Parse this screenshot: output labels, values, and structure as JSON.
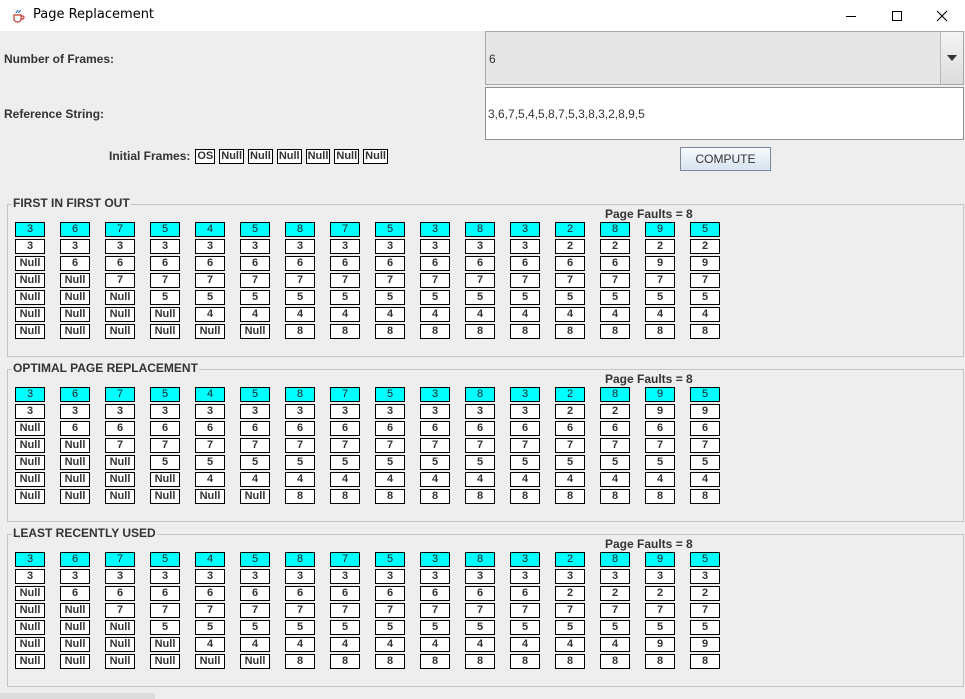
{
  "window": {
    "title": "Page Replacement"
  },
  "form": {
    "frames_label": "Number of Frames:",
    "frames_value": "6",
    "ref_label": "Reference String:",
    "ref_value": "3,6,7,5,4,5,8,7,5,3,8,3,2,8,9,5",
    "initial_label": "Initial Frames:",
    "initial_frames": [
      "OS",
      "Null",
      "Null",
      "Null",
      "Null",
      "Null",
      "Null"
    ],
    "compute_label": "COMPUTE"
  },
  "sections": [
    {
      "id": "fifo",
      "title": "FIRST IN FIRST OUT",
      "faults": "Page Faults = 8",
      "columns": [
        [
          "3",
          "3",
          "Null",
          "Null",
          "Null",
          "Null",
          "Null"
        ],
        [
          "6",
          "3",
          "6",
          "Null",
          "Null",
          "Null",
          "Null"
        ],
        [
          "7",
          "3",
          "6",
          "7",
          "Null",
          "Null",
          "Null"
        ],
        [
          "5",
          "3",
          "6",
          "7",
          "5",
          "Null",
          "Null"
        ],
        [
          "4",
          "3",
          "6",
          "7",
          "5",
          "4",
          "Null"
        ],
        [
          "5",
          "3",
          "6",
          "7",
          "5",
          "4",
          "Null"
        ],
        [
          "8",
          "3",
          "6",
          "7",
          "5",
          "4",
          "8"
        ],
        [
          "7",
          "3",
          "6",
          "7",
          "5",
          "4",
          "8"
        ],
        [
          "5",
          "3",
          "6",
          "7",
          "5",
          "4",
          "8"
        ],
        [
          "3",
          "3",
          "6",
          "7",
          "5",
          "4",
          "8"
        ],
        [
          "8",
          "3",
          "6",
          "7",
          "5",
          "4",
          "8"
        ],
        [
          "3",
          "3",
          "6",
          "7",
          "5",
          "4",
          "8"
        ],
        [
          "2",
          "2",
          "6",
          "7",
          "5",
          "4",
          "8"
        ],
        [
          "8",
          "2",
          "6",
          "7",
          "5",
          "4",
          "8"
        ],
        [
          "9",
          "2",
          "9",
          "7",
          "5",
          "4",
          "8"
        ],
        [
          "5",
          "2",
          "9",
          "7",
          "5",
          "4",
          "8"
        ]
      ]
    },
    {
      "id": "optimal",
      "title": "OPTIMAL PAGE REPLACEMENT",
      "faults": "Page Faults = 8",
      "columns": [
        [
          "3",
          "3",
          "Null",
          "Null",
          "Null",
          "Null",
          "Null"
        ],
        [
          "6",
          "3",
          "6",
          "Null",
          "Null",
          "Null",
          "Null"
        ],
        [
          "7",
          "3",
          "6",
          "7",
          "Null",
          "Null",
          "Null"
        ],
        [
          "5",
          "3",
          "6",
          "7",
          "5",
          "Null",
          "Null"
        ],
        [
          "4",
          "3",
          "6",
          "7",
          "5",
          "4",
          "Null"
        ],
        [
          "5",
          "3",
          "6",
          "7",
          "5",
          "4",
          "Null"
        ],
        [
          "8",
          "3",
          "6",
          "7",
          "5",
          "4",
          "8"
        ],
        [
          "7",
          "3",
          "6",
          "7",
          "5",
          "4",
          "8"
        ],
        [
          "5",
          "3",
          "6",
          "7",
          "5",
          "4",
          "8"
        ],
        [
          "3",
          "3",
          "6",
          "7",
          "5",
          "4",
          "8"
        ],
        [
          "8",
          "3",
          "6",
          "7",
          "5",
          "4",
          "8"
        ],
        [
          "3",
          "3",
          "6",
          "7",
          "5",
          "4",
          "8"
        ],
        [
          "2",
          "2",
          "6",
          "7",
          "5",
          "4",
          "8"
        ],
        [
          "8",
          "2",
          "6",
          "7",
          "5",
          "4",
          "8"
        ],
        [
          "9",
          "9",
          "6",
          "7",
          "5",
          "4",
          "8"
        ],
        [
          "5",
          "9",
          "6",
          "7",
          "5",
          "4",
          "8"
        ]
      ]
    },
    {
      "id": "lru",
      "title": "LEAST RECENTLY USED",
      "faults": "Page Faults = 8",
      "columns": [
        [
          "3",
          "3",
          "Null",
          "Null",
          "Null",
          "Null",
          "Null"
        ],
        [
          "6",
          "3",
          "6",
          "Null",
          "Null",
          "Null",
          "Null"
        ],
        [
          "7",
          "3",
          "6",
          "7",
          "Null",
          "Null",
          "Null"
        ],
        [
          "5",
          "3",
          "6",
          "7",
          "5",
          "Null",
          "Null"
        ],
        [
          "4",
          "3",
          "6",
          "7",
          "5",
          "4",
          "Null"
        ],
        [
          "5",
          "3",
          "6",
          "7",
          "5",
          "4",
          "Null"
        ],
        [
          "8",
          "3",
          "6",
          "7",
          "5",
          "4",
          "8"
        ],
        [
          "7",
          "3",
          "6",
          "7",
          "5",
          "4",
          "8"
        ],
        [
          "5",
          "3",
          "6",
          "7",
          "5",
          "4",
          "8"
        ],
        [
          "3",
          "3",
          "6",
          "7",
          "5",
          "4",
          "8"
        ],
        [
          "8",
          "3",
          "6",
          "7",
          "5",
          "4",
          "8"
        ],
        [
          "3",
          "3",
          "6",
          "7",
          "5",
          "4",
          "8"
        ],
        [
          "2",
          "3",
          "2",
          "7",
          "5",
          "4",
          "8"
        ],
        [
          "8",
          "3",
          "2",
          "7",
          "5",
          "4",
          "8"
        ],
        [
          "9",
          "3",
          "2",
          "7",
          "5",
          "9",
          "8"
        ],
        [
          "5",
          "3",
          "2",
          "7",
          "5",
          "9",
          "8"
        ]
      ]
    }
  ],
  "colors": {
    "reference_cell": "#00ffff",
    "background": "#eeeeee"
  },
  "icons": {
    "app": "java-cup-icon",
    "minimize": "minimize-icon",
    "maximize": "maximize-icon",
    "close": "close-icon",
    "dropdown": "triangle-down-icon"
  }
}
